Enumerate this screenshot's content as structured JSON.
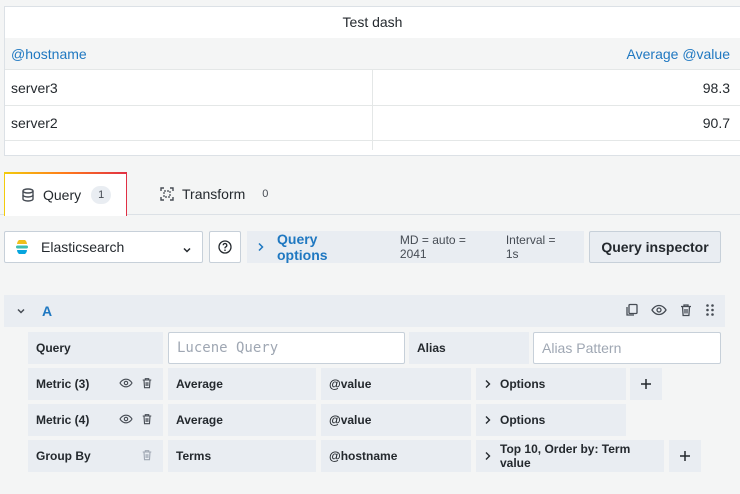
{
  "panel": {
    "title": "Test dash",
    "columns": [
      "@hostname",
      "Average @value"
    ],
    "rows": [
      {
        "hostname": "server3",
        "value": "98.3"
      },
      {
        "hostname": "server2",
        "value": "90.7"
      }
    ]
  },
  "tabs": [
    {
      "label": "Query",
      "count": "1",
      "icon": "database-icon"
    },
    {
      "label": "Transform",
      "count": "0",
      "icon": "transform-icon"
    }
  ],
  "datasource": {
    "name": "Elasticsearch"
  },
  "query_options": {
    "label": "Query options",
    "md": "MD = auto = 2041",
    "interval": "Interval = 1s"
  },
  "inspector": {
    "label": "Query inspector"
  },
  "query": {
    "letter": "A",
    "query_label": "Query",
    "query_placeholder": "Lucene Query",
    "alias_label": "Alias",
    "alias_placeholder": "Alias Pattern",
    "metrics": [
      {
        "label": "Metric (3)",
        "type": "Average",
        "field": "@value",
        "options": "Options"
      },
      {
        "label": "Metric (4)",
        "type": "Average",
        "field": "@value",
        "options": "Options"
      }
    ],
    "group_by": {
      "label": "Group By",
      "type": "Terms",
      "field": "@hostname",
      "options": "Top 10, Order by: Term value"
    }
  },
  "colors": {
    "accent": "#1f78c1",
    "panel_bg": "#ffffff",
    "page_bg": "#f4f5f5",
    "segment_bg": "#e9edf2"
  }
}
